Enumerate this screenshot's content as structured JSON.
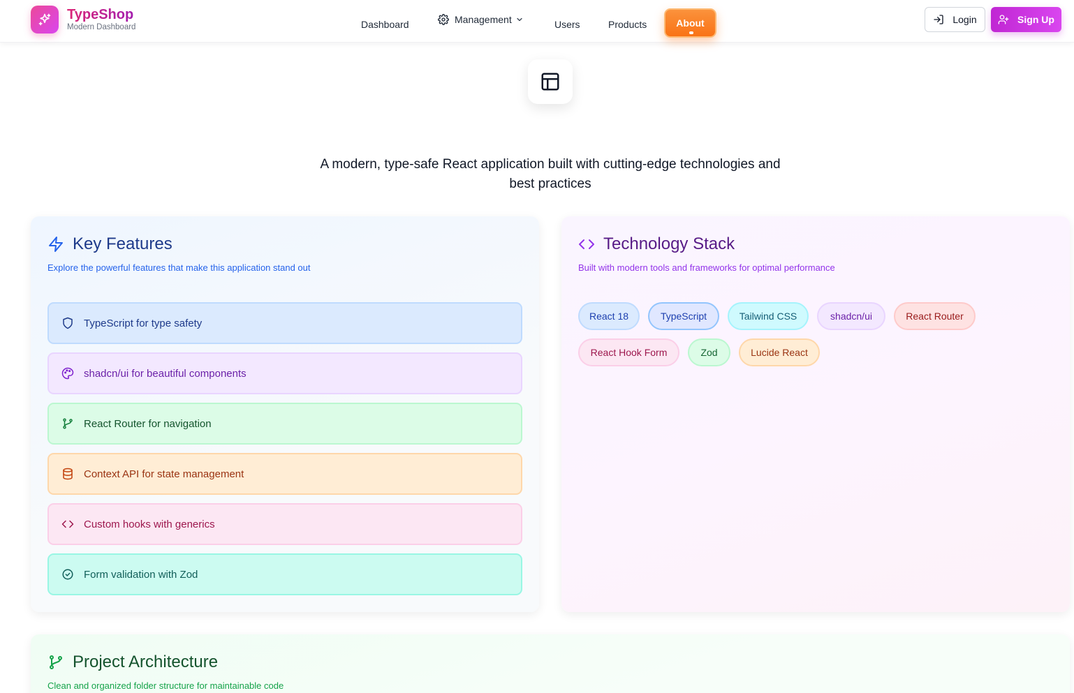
{
  "brand": {
    "name": "TypeShop",
    "subtitle": "Modern Dashboard",
    "logo_icon": "sparkles-icon"
  },
  "nav": {
    "items": [
      {
        "label": "Dashboard"
      },
      {
        "label": "Management",
        "icon": "gear-icon",
        "has_dropdown": true
      },
      {
        "label": "Users"
      },
      {
        "label": "Products"
      },
      {
        "label": "About",
        "active": true
      }
    ]
  },
  "auth": {
    "login_label": "Login",
    "signup_label": "Sign Up"
  },
  "hero": {
    "icon": "layout-icon",
    "tagline": "A modern, type-safe React application built with cutting-edge technologies and best practices"
  },
  "features_card": {
    "title": "Key Features",
    "description": "Explore the powerful features that make this application stand out",
    "items": [
      {
        "label": "TypeScript for type safety",
        "icon": "shield-icon",
        "color": "#dbeafe"
      },
      {
        "label": "shadcn/ui for beautiful components",
        "icon": "palette-icon",
        "color": "#f3e8ff"
      },
      {
        "label": "React Router for navigation",
        "icon": "git-branch-icon",
        "color": "#dcfce7"
      },
      {
        "label": "Context API for state management",
        "icon": "database-icon",
        "color": "#ffedd5"
      },
      {
        "label": "Custom hooks with generics",
        "icon": "code-icon",
        "color": "#fce7f3"
      },
      {
        "label": "Form validation with Zod",
        "icon": "check-circle-icon",
        "color": "#ccfbf1"
      }
    ]
  },
  "stack_card": {
    "title": "Technology Stack",
    "description": "Built with modern tools and frameworks for optimal performance",
    "badges": [
      {
        "label": "React 18"
      },
      {
        "label": "TypeScript"
      },
      {
        "label": "Tailwind CSS"
      },
      {
        "label": "shadcn/ui"
      },
      {
        "label": "React Router"
      },
      {
        "label": "React Hook Form"
      },
      {
        "label": "Zod"
      },
      {
        "label": "Lucide React"
      }
    ]
  },
  "architecture_card": {
    "title": "Project Architecture",
    "description": "Clean and organized folder structure for maintainable code"
  },
  "colors": {
    "brand": "#c026d3",
    "about_active": "#f97316",
    "signup": "#d946ef"
  }
}
